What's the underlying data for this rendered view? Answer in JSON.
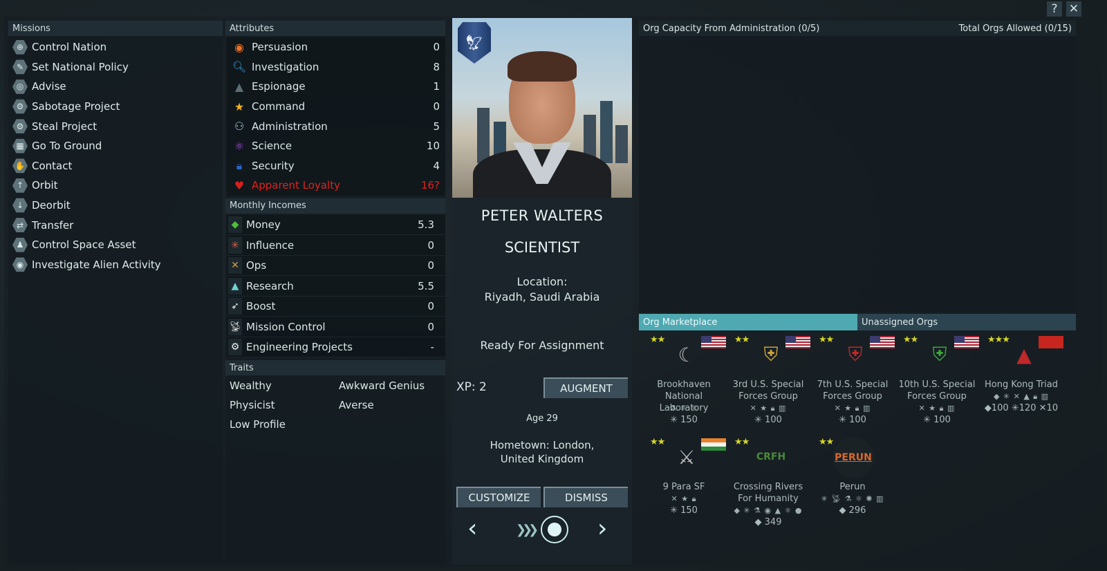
{
  "window": {
    "help_label": "?",
    "close_label": "✕"
  },
  "missions": {
    "header": "Missions",
    "items": [
      {
        "label": "Control Nation",
        "icon": "control-nation-icon"
      },
      {
        "label": "Set National Policy",
        "icon": "set-national-policy-icon"
      },
      {
        "label": "Advise",
        "icon": "advise-icon"
      },
      {
        "label": "Sabotage Project",
        "icon": "sabotage-project-icon"
      },
      {
        "label": "Steal Project",
        "icon": "steal-project-icon"
      },
      {
        "label": "Go To Ground",
        "icon": "go-to-ground-icon"
      },
      {
        "label": "Contact",
        "icon": "contact-icon"
      },
      {
        "label": "Orbit",
        "icon": "orbit-icon"
      },
      {
        "label": "Deorbit",
        "icon": "deorbit-icon"
      },
      {
        "label": "Transfer",
        "icon": "transfer-icon"
      },
      {
        "label": "Control Space Asset",
        "icon": "control-space-asset-icon"
      },
      {
        "label": "Investigate Alien Activity",
        "icon": "investigate-alien-activity-icon"
      }
    ]
  },
  "attributes": {
    "header": "Attributes",
    "items": [
      {
        "label": "Persuasion",
        "value": "0",
        "icon": "persuasion-icon",
        "glyph": "◉",
        "color": "#e8722a"
      },
      {
        "label": "Investigation",
        "value": "8",
        "icon": "investigation-icon",
        "glyph": "🔍︎",
        "color": "#3a9ad8"
      },
      {
        "label": "Espionage",
        "value": "1",
        "icon": "espionage-icon",
        "glyph": "▲",
        "color": "#5b6e74"
      },
      {
        "label": "Command",
        "value": "0",
        "icon": "command-icon",
        "glyph": "★",
        "color": "#f2b31c"
      },
      {
        "label": "Administration",
        "value": "5",
        "icon": "administration-icon",
        "glyph": "⚇",
        "color": "#9cc7e0"
      },
      {
        "label": "Science",
        "value": "10",
        "icon": "science-icon",
        "glyph": "⚛",
        "color": "#a24fd8"
      },
      {
        "label": "Security",
        "value": "4",
        "icon": "security-icon",
        "glyph": "🔒︎",
        "color": "#2a63c9"
      },
      {
        "label": "Apparent Loyalty",
        "value": "16?",
        "icon": "heart-icon",
        "glyph": "♥",
        "color": "#d81e1e"
      }
    ]
  },
  "incomes": {
    "header": "Monthly Incomes",
    "items": [
      {
        "label": "Money",
        "value": "5.3",
        "icon": "money-icon",
        "glyph": "◆",
        "color": "#4fbf3a"
      },
      {
        "label": "Influence",
        "value": "0",
        "icon": "influence-icon",
        "glyph": "✳",
        "color": "#ea5a3a"
      },
      {
        "label": "Ops",
        "value": "0",
        "icon": "ops-icon",
        "glyph": "✕",
        "color": "#d79a4a"
      },
      {
        "label": "Research",
        "value": "5.5",
        "icon": "research-icon",
        "glyph": "▲",
        "color": "#6fd0d0"
      },
      {
        "label": "Boost",
        "value": "0",
        "icon": "boost-icon",
        "glyph": "➶",
        "color": "#f0f0f0"
      },
      {
        "label": "Mission Control",
        "value": "0",
        "icon": "mission-control-icon",
        "glyph": "📡︎",
        "color": "#e0e0e0"
      },
      {
        "label": "Engineering Projects",
        "value": "-",
        "icon": "engineering-projects-icon",
        "glyph": "⚙",
        "color": "#f0f0f0"
      }
    ]
  },
  "traits": {
    "header": "Traits",
    "items": [
      "Wealthy",
      "Awkward Genius",
      "Physicist",
      "Averse",
      "Low Profile"
    ]
  },
  "councilor": {
    "name": "PETER WALTERS",
    "role": "SCIENTIST",
    "location_label": "Location:",
    "location": "Riyadh, Saudi Arabia",
    "status": "Ready For Assignment",
    "xp": "XP: 2",
    "augment_label": "AUGMENT",
    "age": "Age 29",
    "hometown": "Hometown: London, United Kingdom",
    "customize_label": "CUSTOMIZE",
    "dismiss_label": "DISMISS",
    "prev_label": "‹",
    "next_label": "›",
    "chevrons": "❯❯❯"
  },
  "orgs_panel": {
    "capacity_label": "Org Capacity From Administration (0/5)",
    "total_label": "Total Orgs Allowed (0/15)",
    "tabs": [
      {
        "label": "Org Marketplace",
        "active": true
      },
      {
        "label": "Unassigned Orgs",
        "active": false
      }
    ],
    "orgs": [
      {
        "name": "Brookhaven National Laboratory",
        "stars": "★★",
        "flag": "us",
        "logo": "☾",
        "logo_color": "#b9b9b9",
        "bonuses": "⚗ ⚛ ⚛",
        "cost": "✳ 150"
      },
      {
        "name": "3rd U.S. Special Forces Group",
        "stars": "★★",
        "flag": "us",
        "logo": "⛨",
        "logo_color": "#c9a23a",
        "bonuses": "✕ ★ 🔒︎ ▥",
        "cost": "✳ 100"
      },
      {
        "name": "7th U.S. Special Forces Group",
        "stars": "★★",
        "flag": "us",
        "logo": "⛨",
        "logo_color": "#c0282a",
        "bonuses": "✕ ★ 🔒︎ ▥",
        "cost": "✳ 100"
      },
      {
        "name": "10th U.S. Special Forces Group",
        "stars": "★★",
        "flag": "us",
        "logo": "⛨",
        "logo_color": "#3aa83a",
        "bonuses": "✕ ★ 🔒︎ ▥",
        "cost": "✳ 100"
      },
      {
        "name": "Hong Kong Triad",
        "stars": "★★★",
        "flag": "cn",
        "logo": "▲",
        "logo_color": "#c0282a",
        "bonuses": "◆ ✳ ✕ ▲ 🔒︎ ▥",
        "cost": "◆100 ✳120 ✕10"
      },
      {
        "name": "9 Para SF",
        "stars": "★★",
        "flag": "in",
        "logo": "⚔",
        "logo_color": "#bdbdbd",
        "bonuses": "✕ ★ 🔒︎",
        "cost": "✳ 150"
      },
      {
        "name": "Crossing Rivers For Humanity",
        "stars": "★★",
        "flag": "",
        "logo": "CRFH",
        "logo_color": "#4a8a3a",
        "bonuses": "◆ ✳ ⚗ ◉ ▲ ⚛ ●",
        "cost": "◆ 349"
      },
      {
        "name": "Perun",
        "stars": "★★",
        "flag": "",
        "logo": "PERUN",
        "logo_color": "#d8692a",
        "bonuses": "✳ 📡︎ ⚗ ⚛ ✺ ▥",
        "cost": "◆ 296"
      }
    ]
  }
}
